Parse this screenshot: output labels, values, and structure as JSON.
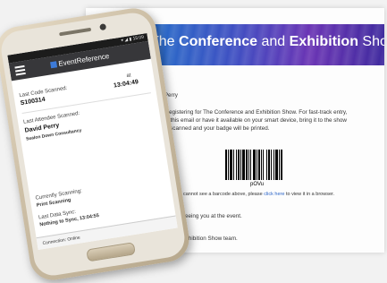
{
  "email": {
    "banner_prefix": "The ",
    "banner_bold1": "Conference",
    "banner_mid": " and ",
    "banner_bold2": "Exhibition",
    "banner_suffix": " Show",
    "greeting": "David Perry",
    "line1": "you for registering for The Conference and Exhibition Show. For fast-track entry,",
    "line2": "print out this email or have it available on your smart device, bring it to the show",
    "line3": "it will be scanned and your badge will be printed.",
    "barcode_text": "pOVu",
    "no_barcode_prefix": "If you cannot see a barcode above, please ",
    "no_barcode_link": "click here",
    "no_barcode_suffix": " to view it in a browser.",
    "closing1": "ard to seeing you at the event.",
    "closing2": "e and Exhibition Show team."
  },
  "phone": {
    "status_time": "15:09",
    "brand": "EventReference",
    "last_code_label": "Last Code Scanned:",
    "last_code_value": "S100314",
    "last_code_time_label": "at",
    "last_code_time": "13:04:49",
    "last_attendee_label": "Last Attendee Scanned:",
    "last_attendee_name": "David Perry",
    "last_attendee_company": "Sealon Down Consultancy",
    "currently_label": "Currently Scanning:",
    "currently_value": "Print Scanning",
    "last_sync_label": "Last Data Sync:",
    "last_sync_value": "Nothing to Sync, 13:04:55",
    "connection": "Connection: Online"
  }
}
